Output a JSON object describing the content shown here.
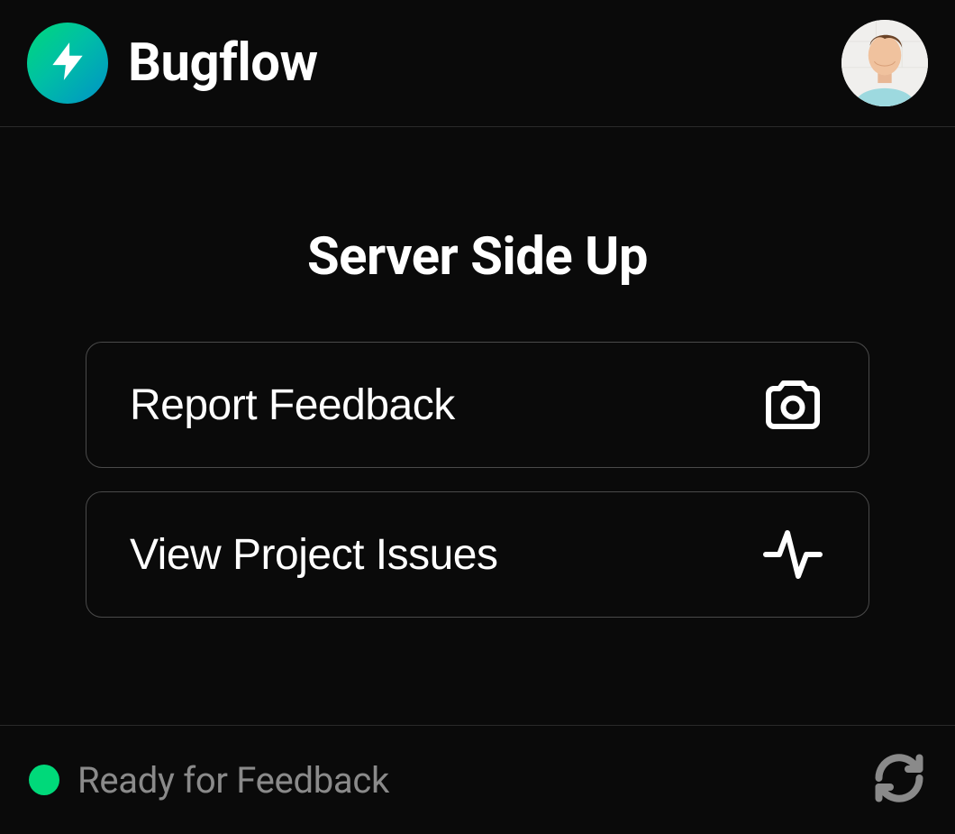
{
  "header": {
    "brand_name": "Bugflow"
  },
  "main": {
    "title": "Server Side Up",
    "actions": [
      {
        "label": "Report Feedback",
        "icon": "camera-icon"
      },
      {
        "label": "View Project Issues",
        "icon": "activity-icon"
      }
    ]
  },
  "footer": {
    "status_text": "Ready for Feedback",
    "status_color": "#00d97a"
  },
  "colors": {
    "accent_gradient_start": "#00d97a",
    "accent_gradient_end": "#0092c7"
  }
}
